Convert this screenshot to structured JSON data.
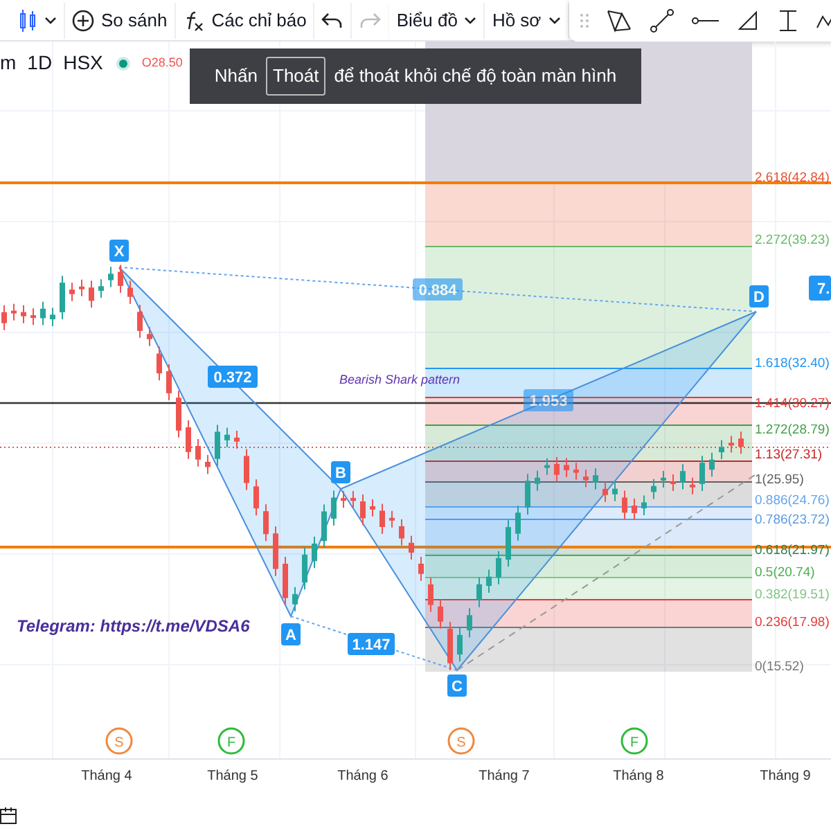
{
  "toolbar": {
    "buttons": [
      {
        "kind": "candles"
      },
      {
        "kind": "compare",
        "label": "So sánh"
      },
      {
        "kind": "indicators",
        "label": "Các chỉ báo"
      },
      {
        "kind": "undo",
        "disabled": false
      },
      {
        "kind": "redo",
        "disabled": true
      },
      {
        "kind": "menu",
        "label": "Biểu đồ"
      },
      {
        "kind": "menu",
        "label": "Hồ sơ"
      }
    ]
  },
  "legend": {
    "symbol": "m",
    "interval": "1D",
    "exchange": "HSX",
    "open": "O28.50"
  },
  "toast": {
    "before": "Nhấn",
    "key": "Thoát",
    "after": "để thoát khỏi chế độ toàn màn hình"
  },
  "fib_levels": [
    {
      "label": "2.618(42.84)",
      "color": "#e8502f"
    },
    {
      "label": "2.272(39.23)",
      "color": "#66bb6a"
    },
    {
      "label": "1.618(32.40)",
      "color": "#2196f3"
    },
    {
      "label": "1.414(30.27)",
      "color": "#e53935"
    },
    {
      "label": "1.272(28.79)",
      "color": "#43a047"
    },
    {
      "label": "1.13(27.31)",
      "color": "#c62828"
    },
    {
      "label": "1(25.95)",
      "color": "#606060"
    },
    {
      "label": "0.886(24.76)",
      "color": "#64a5f0"
    },
    {
      "label": "0.786(23.72)",
      "color": "#5b9ce6"
    },
    {
      "label": "0.618(21.97)",
      "color": "#2e7d4f"
    },
    {
      "label": "0.5(20.74)",
      "color": "#4caf50"
    },
    {
      "label": "0.382(19.51)",
      "color": "#81c784"
    },
    {
      "label": "0.236(17.98)",
      "color": "#e53935"
    },
    {
      "label": "0(15.52)",
      "color": "#787878"
    }
  ],
  "pattern": {
    "title": "Bearish Shark pattern",
    "points": [
      "X",
      "A",
      "B",
      "C",
      "D"
    ],
    "ratios": [
      "0.372",
      "1.147",
      "1.953",
      "0.884"
    ]
  },
  "price_badge": "7.",
  "note": "Telegram: https://t.me/VDSA6",
  "events": [
    {
      "letter": "S",
      "color": "#f0883e"
    },
    {
      "letter": "F",
      "color": "#2dbb3a"
    },
    {
      "letter": "S",
      "color": "#f0883e"
    },
    {
      "letter": "F",
      "color": "#2dbb3a"
    }
  ],
  "months": [
    "Tháng 4",
    "Tháng 5",
    "Tháng 6",
    "Tháng 7",
    "Tháng 8",
    "Tháng 9"
  ]
}
